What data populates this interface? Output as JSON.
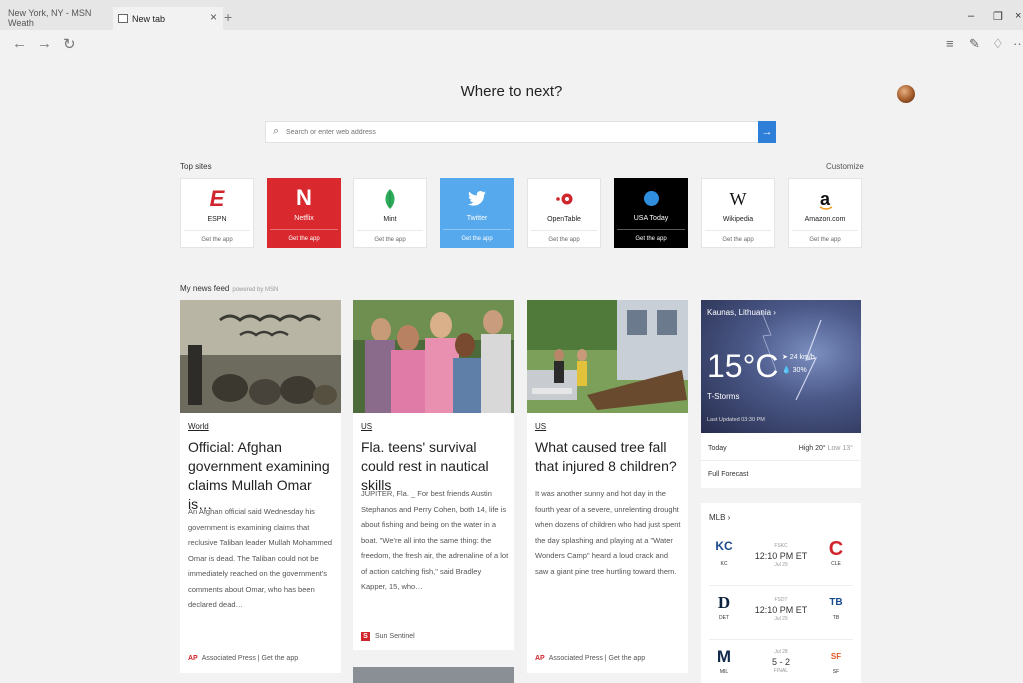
{
  "browser": {
    "tabs": [
      {
        "label": "New York, NY - MSN Weath",
        "icon": "weather-tab-icon"
      },
      {
        "label": "New tab",
        "icon": "newtab-tab-icon"
      }
    ],
    "close_glyph": "×",
    "plus_glyph": "+",
    "window_controls": {
      "minimize": "–",
      "maximize": "❐",
      "close": "×"
    }
  },
  "nav": {
    "back": "←",
    "forward": "→",
    "refresh": "↻",
    "hub": "≡",
    "note": "✎",
    "share": "♢",
    "more": "···"
  },
  "page": {
    "heading": "Where to next?",
    "search_placeholder": "Search or enter web address",
    "top_sites_label": "Top sites",
    "customize_label": "Customize",
    "get_app": "Get the app",
    "news_feed_label": "My news feed",
    "news_feed_powered": "powered by MSN"
  },
  "top_sites": [
    {
      "name": "ESPN",
      "bg": "#ffffff",
      "color": "#d0252c",
      "logo": "E"
    },
    {
      "name": "Netflix",
      "bg": "#d9292e",
      "color": "#ffffff",
      "logo": "N"
    },
    {
      "name": "Mint",
      "bg": "#ffffff",
      "color": "#2cab5b",
      "logo": "◆"
    },
    {
      "name": "Twitter",
      "bg": "#55a9ec",
      "color": "#ffffff",
      "logo": "🐦"
    },
    {
      "name": "OpenTable",
      "bg": "#ffffff",
      "color": "#d0252c",
      "logo": "•●"
    },
    {
      "name": "USA Today",
      "bg": "#000000",
      "color": "#2f8fde",
      "logo": "●"
    },
    {
      "name": "Wikipedia",
      "bg": "#ffffff",
      "color": "#111111",
      "logo": "W"
    },
    {
      "name": "Amazon.com",
      "bg": "#ffffff",
      "color": "#111111",
      "logo": "a"
    }
  ],
  "news": [
    {
      "category": "World",
      "title": "Official: Afghan government examining claims Mullah Omar is…",
      "body": "An Afghan official said Wednesday his government is examining claims that reclusive Taliban leader Mullah Mohammed Omar is dead. The Taliban could not be immediately reached on the government's comments about Omar, who has been declared dead…",
      "source": "Associated Press | Get the app",
      "source_logo": "AP"
    },
    {
      "category": "US",
      "title": "Fla. teens' survival could rest in nautical skills",
      "body": "JUPITER, Fla. _ For best friends Austin Stephanos and Perry Cohen, both 14, life is about fishing and being on the water in a boat. \"We're all into the same thing: the freedom, the fresh air, the adrenaline of a lot of action catching fish,\" said Bradley Kapper, 15, who…",
      "source": "Sun Sentinel",
      "source_logo": "S"
    },
    {
      "category": "US",
      "title": "What caused tree fall that injured 8 children?",
      "body": "It was another sunny and hot day in the fourth year of a severe, unrelenting drought when dozens of children who had just spent the day splashing and playing at a \"Water Wonders Camp\" heard a loud crack and saw a giant pine tree hurtling toward them.",
      "source": "Associated Press | Get the app",
      "source_logo": "AP"
    }
  ],
  "weather": {
    "location": "Kaunas, Lithuania ›",
    "temp": "15°C",
    "wind": "➤ 24 km/h",
    "rain": "💧 30%",
    "condition": "T-Storms",
    "updated": "Last Updated 03:30 PM",
    "today": "Today",
    "high": "High 20°",
    "low": "Low 13°",
    "full_forecast": "Full Forecast"
  },
  "mlb": {
    "header": "MLB ›",
    "games": [
      {
        "away": "KC",
        "away_mark": "KC",
        "away_color": "#1a4b8c",
        "net": "FSKC",
        "time": "12:10 PM ET",
        "date": "Jul 29",
        "home": "CLE",
        "home_mark": "C",
        "home_color": "#d0252c"
      },
      {
        "away": "DET",
        "away_mark": "D",
        "away_color": "#0c2340",
        "net": "FSDT",
        "time": "12:10 PM ET",
        "date": "Jul 29",
        "home": "TB",
        "home_mark": "TB",
        "home_color": "#1a4b8c"
      },
      {
        "away": "MIL",
        "away_mark": "M",
        "away_color": "#12284b",
        "net": "Jul 28",
        "time": "5 - 2",
        "date": "FINAL",
        "home": "SF",
        "home_mark": "SF",
        "home_color": "#e35625"
      }
    ]
  }
}
